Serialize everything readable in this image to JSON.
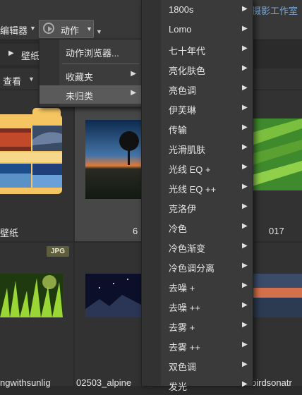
{
  "toolbar": {
    "editor_label": "编辑器",
    "actions_label": "动作",
    "studio_link": "摄影工作室"
  },
  "breadcrumb": {
    "text": "壁纸"
  },
  "view": {
    "label": "查看"
  },
  "grid": {
    "folder_caption": "壁纸",
    "cell2_caption": "6",
    "cell3_caption": "017",
    "jpg_badge": "JPG",
    "bottom_captions": [
      "ngwithsunlig",
      "02503_alpine",
      "birdsonatr"
    ]
  },
  "menu1": {
    "items": [
      {
        "label": "动作浏览器...",
        "submenu": false
      },
      {
        "label": "收藏夹",
        "submenu": true
      },
      {
        "label": "未归类",
        "submenu": true
      }
    ]
  },
  "menu2": {
    "items": [
      "1800s",
      "Lomo",
      "七十年代",
      "亮化肤色",
      "亮色调",
      "伊芙琳",
      "传输",
      "光滑肌肤",
      "光线 EQ +",
      "光线 EQ ++",
      "克洛伊",
      "冷色",
      "冷色渐变",
      "冷色调分离",
      "去噪 +",
      "去噪 ++",
      "去雾 +",
      "去雾 ++",
      "双色调",
      "发光"
    ]
  },
  "icons": {
    "play": "play-circle-icon",
    "submenu": "chevron-right-icon",
    "dropdown": "chevron-down-icon"
  }
}
